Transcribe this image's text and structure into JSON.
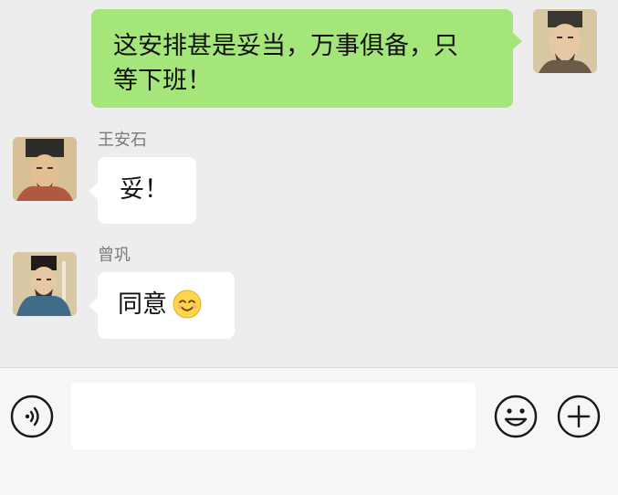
{
  "messages": [
    {
      "sender": "",
      "text": "这安排甚是妥当，万事俱备，只等下班！",
      "line1": "这安排甚是妥当，万事俱备，只",
      "line2": "等下班！"
    },
    {
      "sender": "王安石",
      "text": "妥！"
    },
    {
      "sender": "曾巩",
      "text": "同意",
      "emoji": "smiling-face-icon"
    }
  ],
  "input": {
    "value": "",
    "placeholder": ""
  },
  "colors": {
    "self_bubble": "#a5e67b",
    "other_bubble": "#ffffff",
    "background": "#ededed"
  }
}
